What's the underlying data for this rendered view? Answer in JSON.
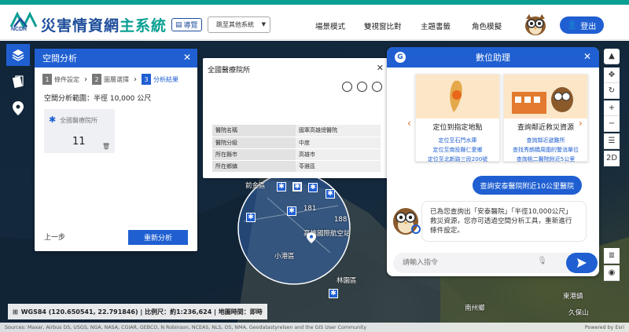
{
  "header": {
    "logo_text": "NCDR",
    "app_title_main": "災害情資網",
    "app_title_sub": "主系統",
    "guide_label": "導覽",
    "system_select_value": "跳至其他系統",
    "nav": [
      "場景模式",
      "雙視窗比對",
      "主題書籤",
      "角色模擬"
    ],
    "logout_label": "登出"
  },
  "spatial_panel": {
    "title": "空間分析",
    "steps": [
      {
        "num": "1",
        "label": "條件設定"
      },
      {
        "num": "2",
        "label": "圖層選擇"
      },
      {
        "num": "3",
        "label": "分析結果"
      }
    ],
    "range_text": "空間分析範圍：半徑 10,000 公尺",
    "result_name": "全國醫療院所",
    "result_count": "11",
    "back_label": "上一步",
    "reanalyze_label": "重新分析"
  },
  "hospital_panel": {
    "title": "全國醫療院所",
    "rows": [
      {
        "key": "醫院名稱",
        "value": "國軍高雄總醫院"
      },
      {
        "key": "醫院分級",
        "value": "中度"
      },
      {
        "key": "所在縣市",
        "value": "高雄市"
      },
      {
        "key": "所在鄉鎮",
        "value": "苓雅區"
      }
    ]
  },
  "assistant": {
    "title": "數位助理",
    "cards": [
      {
        "title": "定位到指定地點",
        "links": [
          "定位至石門水庫",
          "定位至南投縣仁愛鄉",
          "定位至北新路三段200號"
        ]
      },
      {
        "title": "查詢鄰近救災資源",
        "links": [
          "查詢鄰近避難所",
          "查找秀朗橋周圍的警消單位",
          "查詢桃二醫院附近5公里"
        ]
      }
    ],
    "user_query": "查詢安泰醫院附近10公里醫院",
    "reply": "已為您查詢出「安泰醫院」「半徑10,000公尺」救災資源，您亦可透過空間分析工具，重新進行條件設定。",
    "input_placeholder": "請輸入指令"
  },
  "map": {
    "labels": [
      "前金區",
      "181",
      "188",
      "高雄國際航空站",
      "小港區",
      "林園區",
      "東港鎮",
      "南州鄉",
      "久保山"
    ],
    "status": "WGS84 (120.650541, 22.791846) | 比例尺：約1:236,624 | 地圖時間：即時",
    "attribution": "Sources: Maxar, Airbus DS, USGS, NGA, NASA, CGIAR, GEBCO, N Robinson, NCEAS, NLS, OS, NMA, Geodatastyrelsen and the GIS User Community",
    "powered_by": "Powered by Esri"
  },
  "right_tools": [
    "compass",
    "pan",
    "refresh",
    "zoom-in",
    "zoom-out",
    "list",
    "2D",
    "layers",
    "eye"
  ],
  "colors": {
    "primary": "#1f5fd1",
    "accent": "#0a9f93"
  }
}
